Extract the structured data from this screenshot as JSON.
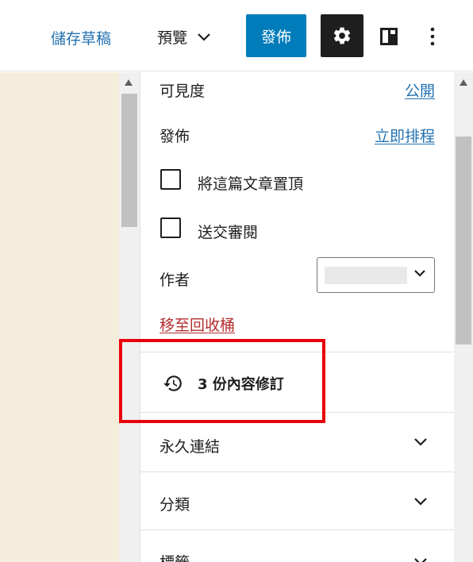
{
  "header": {
    "save_draft": "儲存草稿",
    "preview": "預覽",
    "publish": "發佈"
  },
  "summary": {
    "visibility_label": "可見度",
    "visibility_value": "公開",
    "publish_label": "發佈",
    "publish_value": "立即排程",
    "sticky_label": "將這篇文章置頂",
    "pending_review_label": "送交審閱",
    "author_label": "作者",
    "author_value": "",
    "trash": "移至回收桶"
  },
  "revisions": {
    "label": "3 份內容修訂"
  },
  "panels": [
    {
      "title": "永久連結"
    },
    {
      "title": "分類"
    },
    {
      "title": "標籤"
    }
  ],
  "colors": {
    "accent": "#007cba",
    "link": "#2271b1",
    "trash": "#b32d2e",
    "highlight": "#e8000a",
    "canvas": "#f5eddc"
  },
  "icons": [
    "chevron-down-icon",
    "gear-icon",
    "layout-icon",
    "more-vertical-icon",
    "history-icon"
  ]
}
